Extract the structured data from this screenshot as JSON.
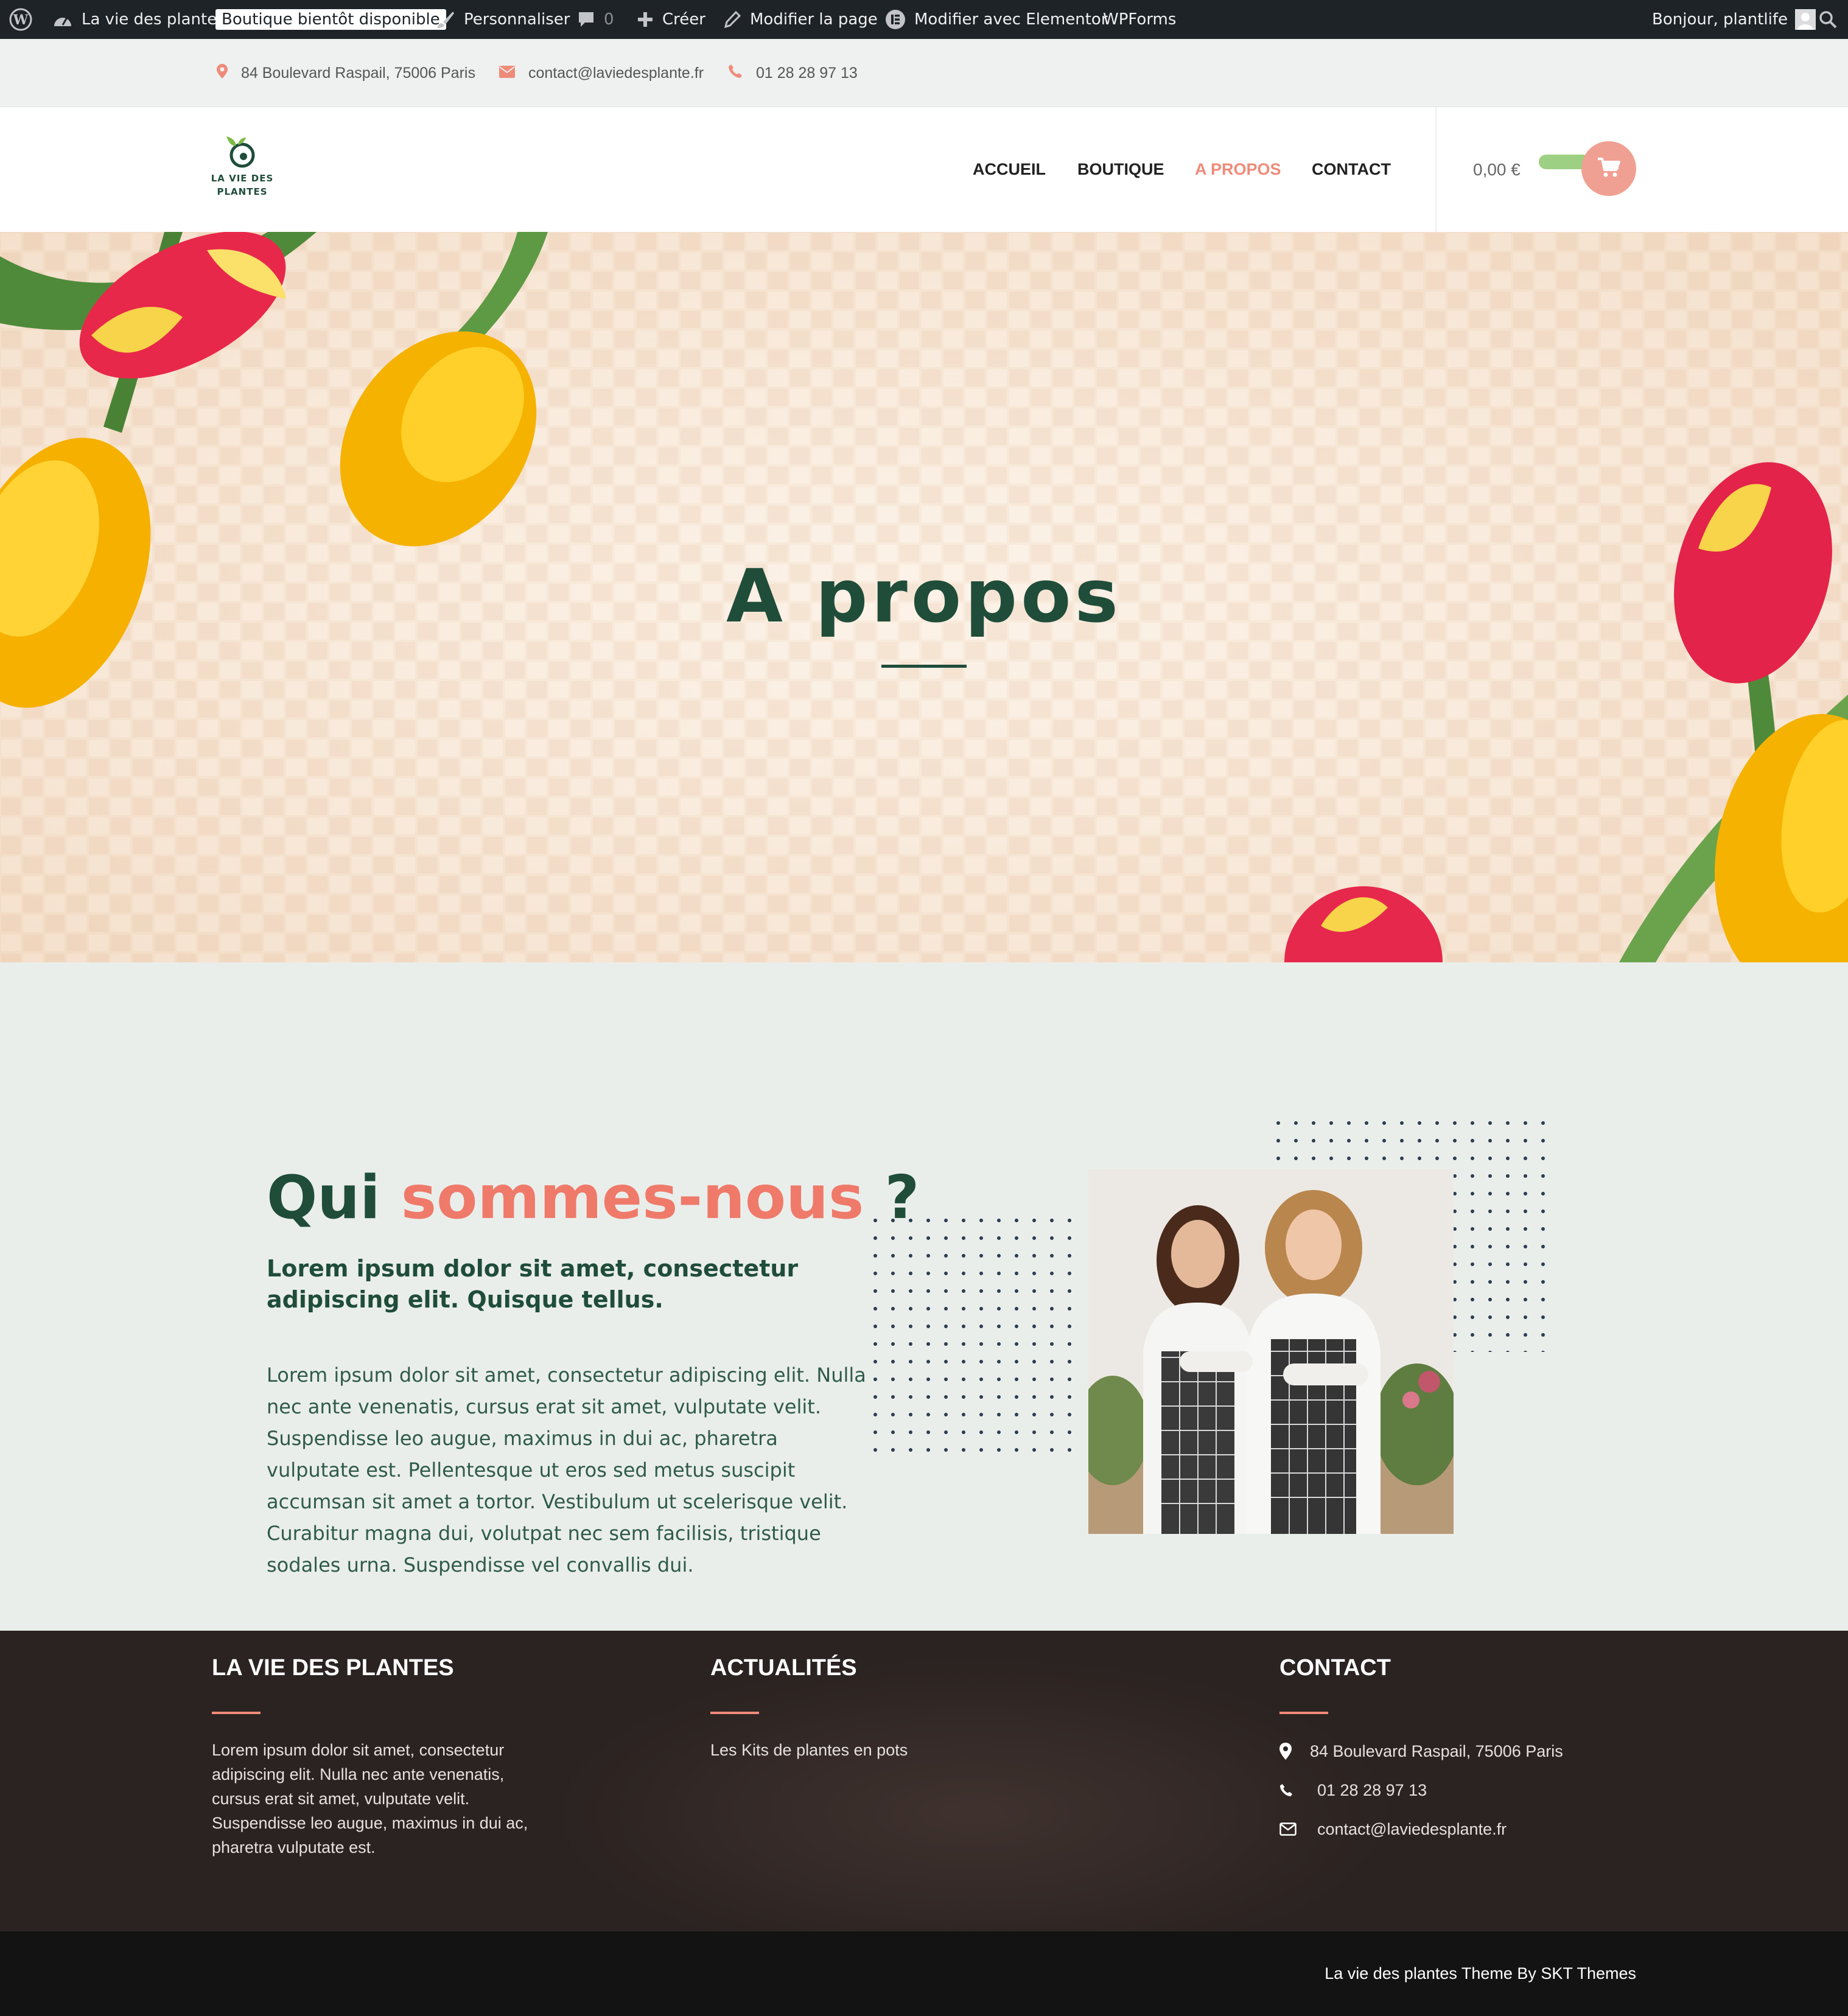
{
  "admin_bar": {
    "site_name": "La vie des plantes",
    "badge": "Boutique bientôt disponible",
    "customize": "Personnaliser",
    "comments_count": "0",
    "new": "Créer",
    "edit_page": "Modifier la page",
    "edit_elementor": "Modifier avec Elementor",
    "wpforms": "WPForms",
    "greeting": "Bonjour, plantlife",
    "icons": [
      "wordpress-icon",
      "dashboard-icon",
      "brush-icon",
      "comment-icon",
      "plus-icon",
      "pencil-icon",
      "elementor-icon",
      "avatar",
      "search-icon"
    ]
  },
  "topbar": {
    "address": "84 Boulevard Raspail, 75006 Paris",
    "email": "contact@laviedesplante.fr",
    "phone": "01 28 28 97 13",
    "icon_color": "#ef8b79"
  },
  "header": {
    "logo_line1": "LA VIE DES",
    "logo_line2": "PLANTES",
    "nav": [
      {
        "label": "ACCUEIL",
        "active": false
      },
      {
        "label": "BOUTIQUE",
        "active": false
      },
      {
        "label": "A PROPOS",
        "active": true
      },
      {
        "label": "CONTACT",
        "active": false
      }
    ],
    "cart_total": "0,00 €"
  },
  "hero": {
    "title": "A propos"
  },
  "about": {
    "title_part1": "Qui ",
    "title_accent": "sommes-nous",
    "title_part2": " ?",
    "lead": "Lorem ipsum dolor sit amet, consectetur adipiscing elit. Quisque tellus.",
    "body": "Lorem ipsum dolor sit amet, consectetur adipiscing elit. Nulla nec ante venenatis, cursus erat sit amet, vulputate velit. Suspendisse leo augue, maximus in dui ac, pharetra vulputate est. Pellentesque ut eros sed metus suscipit accumsan sit amet a tortor. Vestibulum ut scelerisque velit. Curabitur magna dui, volutpat nec sem facilisis, tristique sodales urna. Suspendisse vel convallis dui."
  },
  "footer": {
    "col1": {
      "heading": "LA VIE DES PLANTES",
      "text": "Lorem ipsum dolor sit amet, consectetur adipiscing elit. Nulla nec ante venenatis, cursus erat sit amet, vulputate velit. Suspendisse leo augue, maximus in dui ac, pharetra vulputate est."
    },
    "col2": {
      "heading": "ACTUALITÉS",
      "link": "Les Kits de plantes en pots"
    },
    "col3": {
      "heading": "CONTACT",
      "address": "84 Boulevard Raspail, 75006 Paris",
      "phone": "01 28 28 97 13",
      "email": "contact@laviedesplante.fr"
    },
    "credit": "La vie des plantes Theme By SKT Themes"
  },
  "colors": {
    "brand_green": "#1f4d3a",
    "accent_coral": "#ef7a6a",
    "nav_active": "#ef8b79",
    "cart_button": "#f0a092",
    "cart_pill": "#9dd082"
  }
}
